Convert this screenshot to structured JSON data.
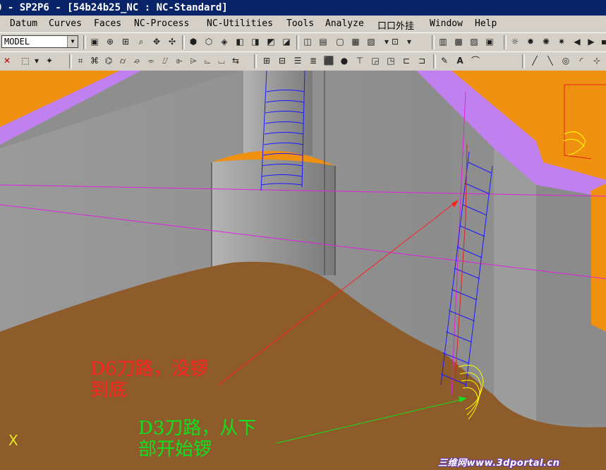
{
  "title": "0 - SP2P6 - [54b24b25_NC : NC-Standard]",
  "menu": [
    "Datum",
    "Curves",
    "Faces",
    "NC-Process",
    "NC-Utilities",
    "Tools",
    "Analyze",
    "口口外挂",
    "Window",
    "Help"
  ],
  "toolbar": {
    "model_select": "MODEL"
  },
  "annotations": {
    "red_line1": "D6刀路，没锣",
    "red_line2": "到底",
    "green_line1": "D3刀路，从下",
    "green_line2": "部开始锣"
  },
  "axis_label": "X",
  "watermark": "三维网www.3dportal.cn",
  "colors": {
    "title_bg": "#0a246a",
    "model_gray": "#a0a0a0",
    "floor_brown": "#8e5c2a",
    "orange": "#f09010",
    "purple": "#c080f0",
    "toolpath_blue": "#1a1aff",
    "toolpath_yellow": "#ffff00",
    "red_note": "#ff2020",
    "green_note": "#10e020"
  }
}
